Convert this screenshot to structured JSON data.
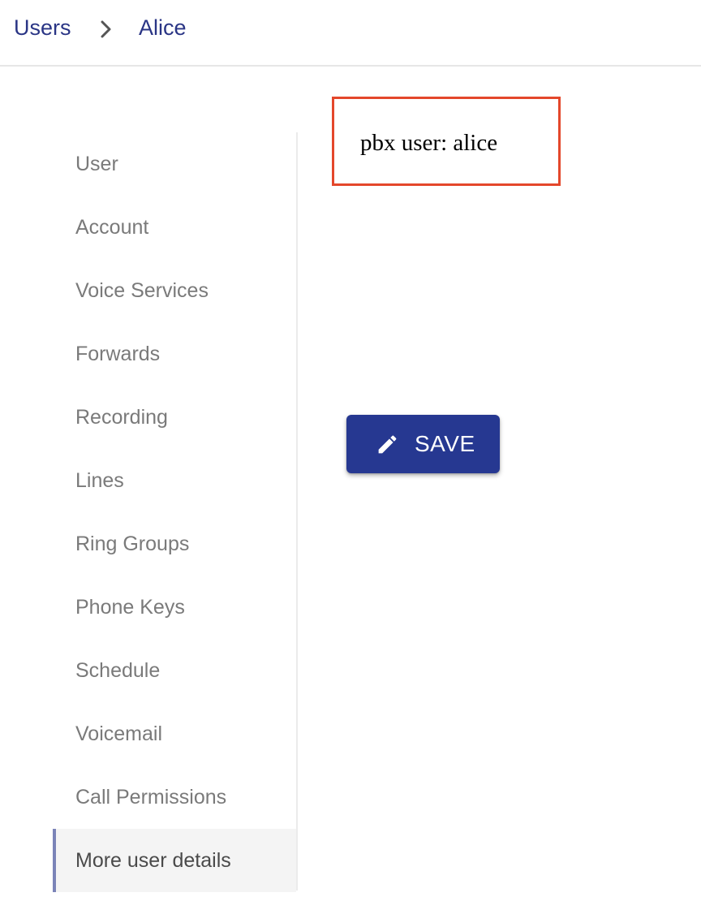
{
  "breadcrumb": {
    "root": "Users",
    "current": "Alice",
    "separator_icon": "chevron-right-icon"
  },
  "sidebar": {
    "items": [
      {
        "label": "User"
      },
      {
        "label": "Account"
      },
      {
        "label": "Voice Services"
      },
      {
        "label": "Forwards"
      },
      {
        "label": "Recording"
      },
      {
        "label": "Lines"
      },
      {
        "label": "Ring Groups"
      },
      {
        "label": "Phone Keys"
      },
      {
        "label": "Schedule"
      },
      {
        "label": "Voicemail"
      },
      {
        "label": "Call Permissions"
      },
      {
        "label": "More user details",
        "active": true
      }
    ]
  },
  "main": {
    "pbx_text": "pbx user: alice",
    "save_label": "SAVE",
    "save_icon": "pencil-icon"
  },
  "colors": {
    "accent": "#263891",
    "link": "#2a3585",
    "highlight_border": "#e4472b",
    "active_indicator": "#7b84b8"
  }
}
